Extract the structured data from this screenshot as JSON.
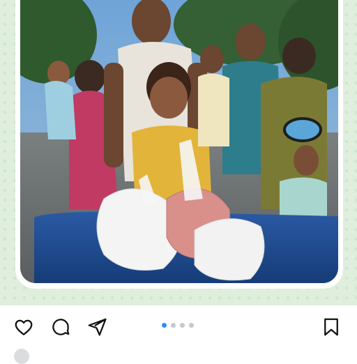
{
  "post": {
    "carousel": {
      "count": 4,
      "active_index": 0
    },
    "colors": {
      "accent": "#2f8ff0",
      "icon": "#111111",
      "background": "#dfeedd"
    },
    "actions": {
      "like_icon": "heart-icon",
      "comment_icon": "comment-icon",
      "share_icon": "send-icon",
      "save_icon": "bookmark-icon"
    }
  }
}
